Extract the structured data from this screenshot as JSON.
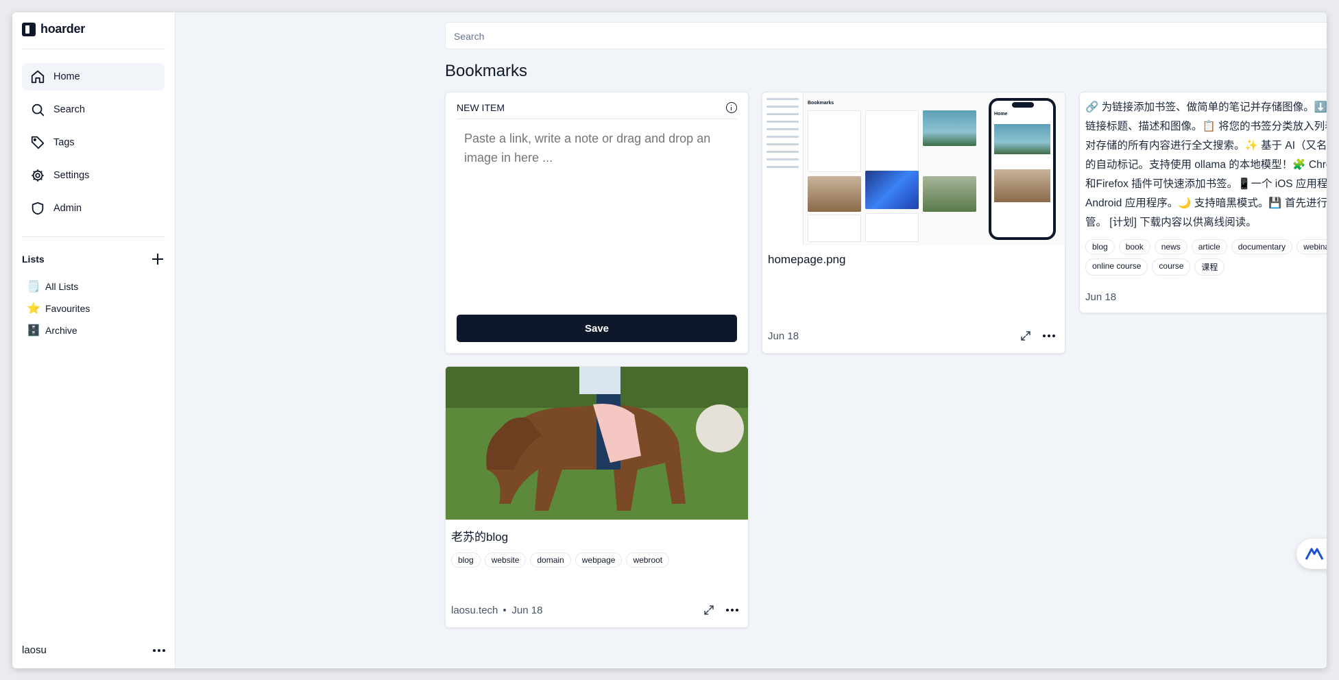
{
  "app": {
    "name": "hoarder"
  },
  "sidebar": {
    "nav": [
      {
        "label": "Home",
        "icon": "home-icon"
      },
      {
        "label": "Search",
        "icon": "search-icon"
      },
      {
        "label": "Tags",
        "icon": "tag-icon"
      },
      {
        "label": "Settings",
        "icon": "gear-icon"
      },
      {
        "label": "Admin",
        "icon": "shield-icon"
      }
    ],
    "lists_title": "Lists",
    "lists": [
      {
        "label": "All Lists",
        "icon": "notepad-emoji",
        "emoji": "🗒️"
      },
      {
        "label": "Favourites",
        "icon": "star-emoji",
        "emoji": "⭐"
      },
      {
        "label": "Archive",
        "icon": "file-cabinet-emoji",
        "emoji": "🗄️"
      }
    ],
    "user": "laosu"
  },
  "search": {
    "placeholder": "Search"
  },
  "page_title": "Bookmarks",
  "new_item": {
    "title": "NEW ITEM",
    "placeholder": "Paste a link, write a note or drag and drop an image in here ...",
    "save_label": "Save"
  },
  "image_card": {
    "title": "homepage.png",
    "date": "Jun 18",
    "preview": {
      "app_title": "Bookmarks",
      "phone_title": "Home"
    }
  },
  "text_card": {
    "body": "🔗 为链接添加书签、做简单的笔记并存储图像。⬇️ 自动获取链接标题、描述和图像。📋 将您的书签分类放入列表中。🔎 对存储的所有内容进行全文搜索。✨ 基于 AI（又名 chatgpt）的自动标记。支持使用 ollama 的本地模型！🧩 Chrome 插件和Firefox 插件可快速添加书签。📱一个 iOS 应用程序和一个Android 应用程序。🌙 支持暗黑模式。💾 首先进行自我托管。 [计划] 下载内容以供离线阅读。",
    "tags": [
      "blog",
      "book",
      "news",
      "article",
      "documentary",
      "webinar",
      "online course",
      "course",
      "课程"
    ],
    "date": "Jun 18"
  },
  "link_card": {
    "title": "老苏的blog",
    "tags": [
      "blog",
      "website",
      "domain",
      "webpage",
      "webroot"
    ],
    "source": "laosu.tech",
    "date": "Jun 18"
  },
  "colors": {
    "primary": "#0f172a",
    "background": "#f1f5f9"
  }
}
